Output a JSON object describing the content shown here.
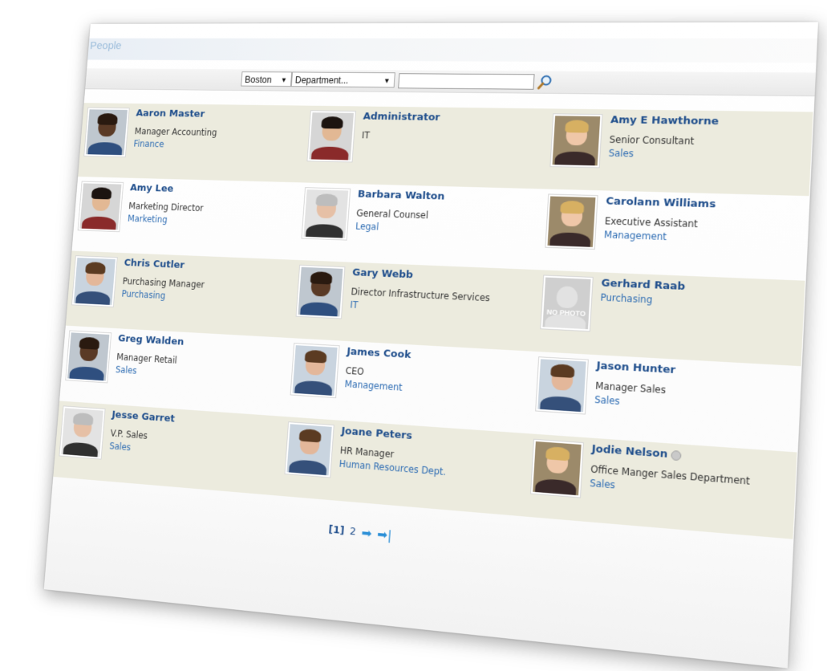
{
  "header": {
    "title": "People"
  },
  "filters": {
    "location": "Boston",
    "department": "Department...",
    "search_value": ""
  },
  "columns": [
    [
      {
        "name": "Aaron Master",
        "title": "Manager Accounting",
        "dept": "Finance",
        "shade": true,
        "photo": "dark"
      },
      {
        "name": "Amy Lee",
        "title": "Marketing Director",
        "dept": "Marketing",
        "shade": false,
        "photo": "asian"
      },
      {
        "name": "Chris Cutler",
        "title": "Purchasing Manager",
        "dept": "Purchasing",
        "shade": true,
        "photo": "light"
      },
      {
        "name": "Greg Walden",
        "title": "Manager Retail",
        "dept": "Sales",
        "shade": false,
        "photo": "dark"
      },
      {
        "name": "Jesse Garret",
        "title": "V.P. Sales",
        "dept": "Sales",
        "shade": true,
        "photo": "gray"
      }
    ],
    [
      {
        "name": "Administrator",
        "title": "IT",
        "dept": "",
        "shade": true,
        "photo": "asian"
      },
      {
        "name": "Barbara Walton",
        "title": "General Counsel",
        "dept": "Legal",
        "shade": false,
        "photo": "gray"
      },
      {
        "name": "Gary Webb",
        "title": "Director Infrastructure Services",
        "dept": "IT",
        "shade": true,
        "photo": "dark"
      },
      {
        "name": "James Cook",
        "title": "CEO",
        "dept": "Management",
        "shade": false,
        "photo": "light"
      },
      {
        "name": "Joane Peters",
        "title": "HR Manager",
        "dept": "Human Resources Dept.",
        "shade": true,
        "photo": "light"
      }
    ],
    [
      {
        "name": "Amy E Hawthorne",
        "title": "Senior Consultant",
        "dept": "Sales",
        "shade": true,
        "photo": "blonde"
      },
      {
        "name": "Carolann Williams",
        "title": "Executive Assistant",
        "dept": "Management",
        "shade": false,
        "photo": "blonde"
      },
      {
        "name": "Gerhard Raab",
        "title": "",
        "dept": "Purchasing",
        "shade": true,
        "photo": "none"
      },
      {
        "name": "Jason Hunter",
        "title": "Manager Sales",
        "dept": "Sales",
        "shade": false,
        "photo": "light"
      },
      {
        "name": "Jodie Nelson",
        "title": "Office Manger Sales Department",
        "dept": "Sales",
        "shade": true,
        "photo": "blonde",
        "presence": true
      }
    ]
  ],
  "no_photo_label": "NO PHOTO",
  "pager": {
    "current": "[1]",
    "next_page": "2"
  }
}
